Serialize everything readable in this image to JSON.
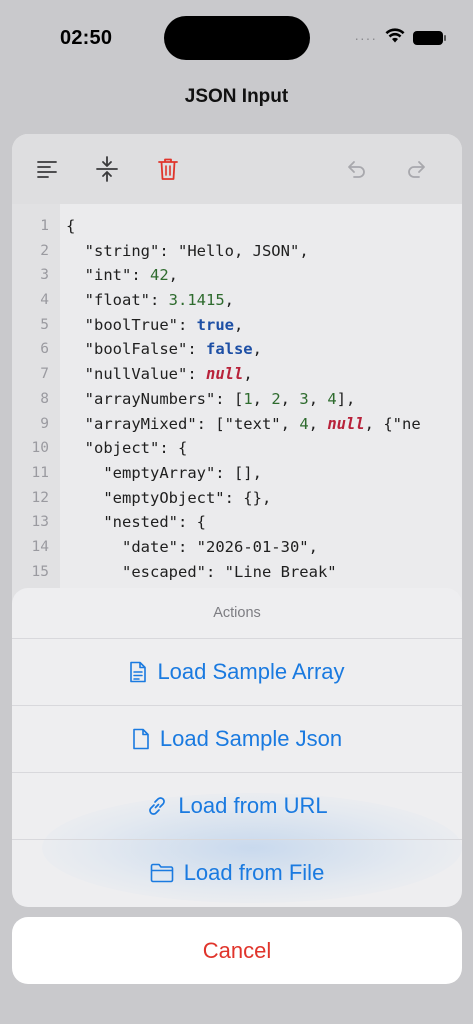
{
  "status": {
    "time": "02:50"
  },
  "nav": {
    "title": "JSON Input"
  },
  "toolbar": {
    "icons": [
      "format-align-left-icon",
      "compress-vertical-icon",
      "trash-icon",
      "undo-icon",
      "redo-icon"
    ],
    "colors": {
      "icon": "#3a3a3c",
      "trash": "#e0342b",
      "disabled": "#a8a8ad"
    }
  },
  "editor": {
    "lines": [
      {
        "n": "1",
        "parts": [
          {
            "t": "{",
            "c": "punc"
          }
        ]
      },
      {
        "n": "2",
        "parts": [
          {
            "t": "  \"string\": ",
            "c": "key"
          },
          {
            "t": "\"Hello, JSON\"",
            "c": "str"
          },
          {
            "t": ",",
            "c": "punc"
          }
        ]
      },
      {
        "n": "3",
        "parts": [
          {
            "t": "  \"int\": ",
            "c": "key"
          },
          {
            "t": "42",
            "c": "num"
          },
          {
            "t": ",",
            "c": "punc"
          }
        ]
      },
      {
        "n": "4",
        "parts": [
          {
            "t": "  \"float\": ",
            "c": "key"
          },
          {
            "t": "3.1415",
            "c": "num"
          },
          {
            "t": ",",
            "c": "punc"
          }
        ]
      },
      {
        "n": "5",
        "parts": [
          {
            "t": "  \"boolTrue\": ",
            "c": "key"
          },
          {
            "t": "true",
            "c": "bool"
          },
          {
            "t": ",",
            "c": "punc"
          }
        ]
      },
      {
        "n": "6",
        "parts": [
          {
            "t": "  \"boolFalse\": ",
            "c": "key"
          },
          {
            "t": "false",
            "c": "bool"
          },
          {
            "t": ",",
            "c": "punc"
          }
        ]
      },
      {
        "n": "7",
        "parts": [
          {
            "t": "  \"nullValue\": ",
            "c": "key"
          },
          {
            "t": "null",
            "c": "null"
          },
          {
            "t": ",",
            "c": "punc"
          }
        ]
      },
      {
        "n": "8",
        "parts": [
          {
            "t": "  \"arrayNumbers\": [",
            "c": "key"
          },
          {
            "t": "1",
            "c": "num"
          },
          {
            "t": ", ",
            "c": "punc"
          },
          {
            "t": "2",
            "c": "num"
          },
          {
            "t": ", ",
            "c": "punc"
          },
          {
            "t": "3",
            "c": "num"
          },
          {
            "t": ", ",
            "c": "punc"
          },
          {
            "t": "4",
            "c": "num"
          },
          {
            "t": "],",
            "c": "punc"
          }
        ]
      },
      {
        "n": "9",
        "parts": [
          {
            "t": "  \"arrayMixed\": [",
            "c": "key"
          },
          {
            "t": "\"text\"",
            "c": "str"
          },
          {
            "t": ", ",
            "c": "punc"
          },
          {
            "t": "4",
            "c": "num"
          },
          {
            "t": ", ",
            "c": "punc"
          },
          {
            "t": "null",
            "c": "null"
          },
          {
            "t": ", {\"ne",
            "c": "punc"
          }
        ]
      },
      {
        "n": "10",
        "parts": [
          {
            "t": "  \"object\": {",
            "c": "key"
          }
        ]
      },
      {
        "n": "11",
        "parts": [
          {
            "t": "    \"emptyArray\": [],",
            "c": "key"
          }
        ]
      },
      {
        "n": "12",
        "parts": [
          {
            "t": "    \"emptyObject\": {},",
            "c": "key"
          }
        ]
      },
      {
        "n": "13",
        "parts": [
          {
            "t": "    \"nested\": {",
            "c": "key"
          }
        ]
      },
      {
        "n": "14",
        "parts": [
          {
            "t": "      \"date\": ",
            "c": "key"
          },
          {
            "t": "\"2026-01-30\"",
            "c": "str"
          },
          {
            "t": ",",
            "c": "punc"
          }
        ]
      },
      {
        "n": "15",
        "parts": [
          {
            "t": "      \"escaped\": ",
            "c": "key"
          },
          {
            "t": "\"Line Break\"",
            "c": "str"
          }
        ]
      }
    ]
  },
  "sheet": {
    "title": "Actions",
    "items": [
      {
        "label": "Load Sample Array",
        "icon": "doc-text-icon"
      },
      {
        "label": "Load Sample Json",
        "icon": "doc-icon"
      },
      {
        "label": "Load from URL",
        "icon": "link-icon"
      },
      {
        "label": "Load from File",
        "icon": "folder-icon"
      }
    ],
    "cancel": "Cancel",
    "accent": "#1a7ae0",
    "destructive": "#e0342b"
  }
}
